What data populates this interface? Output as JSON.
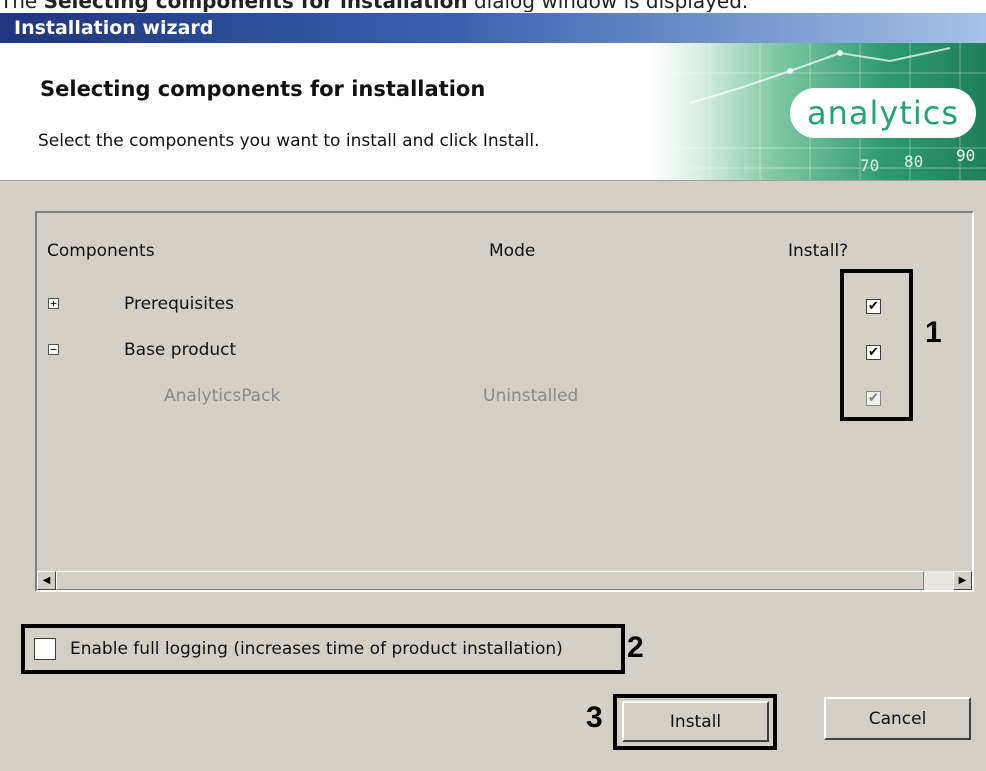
{
  "caption": {
    "prefix": "The ",
    "bold": "Selecting components for installation",
    "suffix": " dialog window is displayed."
  },
  "window": {
    "title": "Installation wizard"
  },
  "header": {
    "title": "Selecting components for installation",
    "subtitle": "Select the components you want to install and click Install.",
    "logo_text": "analytics",
    "banner_numbers": [
      "70",
      "80",
      "90"
    ]
  },
  "components": {
    "columns": {
      "name": "Components",
      "mode": "Mode",
      "install": "Install?"
    },
    "rows": [
      {
        "expander": "+",
        "name": "Prerequisites",
        "mode": "",
        "checked": true,
        "enabled": true
      },
      {
        "expander": "−",
        "name": "Base product",
        "mode": "",
        "checked": true,
        "enabled": true
      },
      {
        "expander": "",
        "name": "AnalyticsPack",
        "mode": "Uninstalled",
        "checked": true,
        "enabled": false
      }
    ]
  },
  "logging": {
    "label": "Enable full logging (increases time of product installation)",
    "checked": false
  },
  "buttons": {
    "install": "Install",
    "cancel": "Cancel"
  },
  "annotations": [
    "1",
    "2",
    "3"
  ],
  "icons": {
    "check": "✔",
    "scroll_left": "◀",
    "scroll_right": "▶"
  },
  "colors": {
    "title_bar": "#20357e",
    "logo": "#27a07a",
    "dialog_bg": "#d4d0c8"
  }
}
